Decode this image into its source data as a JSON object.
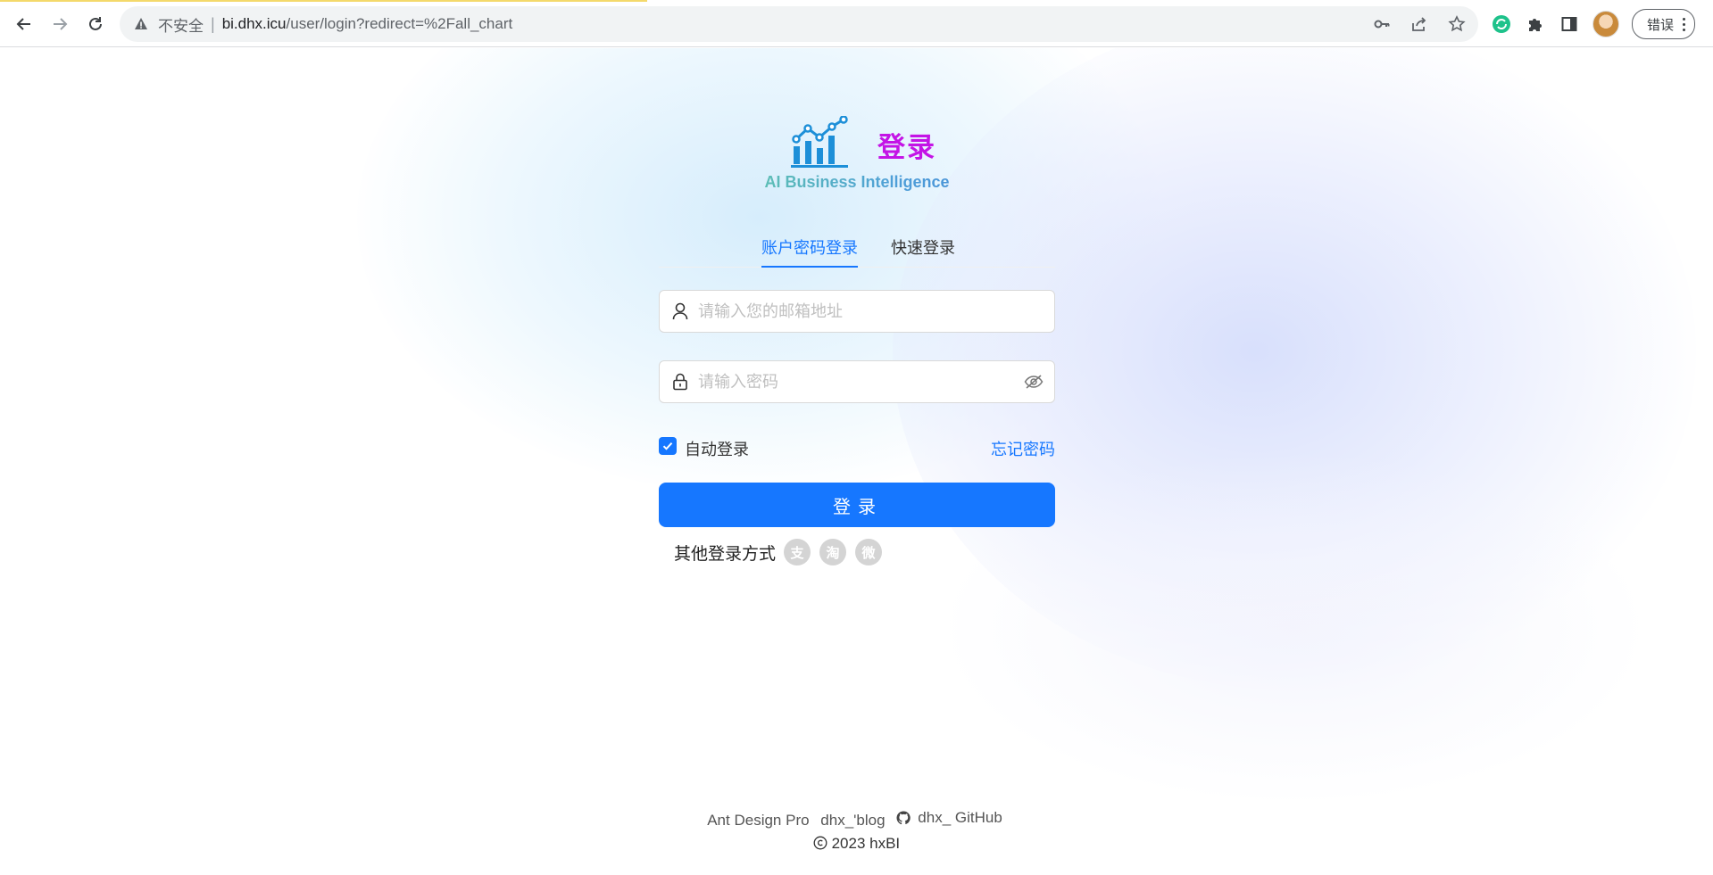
{
  "browser": {
    "security_label": "不安全",
    "separator": "|",
    "url_host": "bi.dhx.icu",
    "url_path": "/user/login?redirect=%2Fall_chart",
    "error_pill_label": "错误",
    "icons": [
      "back-icon",
      "forward-icon",
      "reload-icon",
      "warning-icon",
      "key-icon",
      "share-icon",
      "star-icon",
      "extension-sync-icon",
      "puzzle-icon",
      "sidepanel-icon",
      "profile-avatar-icon",
      "menu-dots-icon"
    ]
  },
  "header": {
    "title": "登录",
    "subtitle": "AI Business Intelligence"
  },
  "tabs": [
    {
      "label": "账户密码登录",
      "active": true
    },
    {
      "label": "快速登录",
      "active": false
    }
  ],
  "form": {
    "email_placeholder": "请输入您的邮箱地址",
    "email_value": "",
    "password_placeholder": "请输入密码",
    "password_value": "",
    "remember_label": "自动登录",
    "remember_checked": true,
    "forgot_label": "忘记密码",
    "submit_label": "登录"
  },
  "other_login": {
    "label": "其他登录方式",
    "providers": [
      {
        "name": "alipay",
        "glyph": "支"
      },
      {
        "name": "taobao",
        "glyph": "淘"
      },
      {
        "name": "weibo",
        "glyph": "微"
      }
    ]
  },
  "footer": {
    "links": [
      "Ant Design Pro",
      "dhx_'blog",
      "dhx_ GitHub"
    ],
    "copyright": "2023 hxBI"
  },
  "colors": {
    "accent": "#1677ff",
    "title": "#c414e6",
    "logo_blue": "#1d8fd8"
  }
}
